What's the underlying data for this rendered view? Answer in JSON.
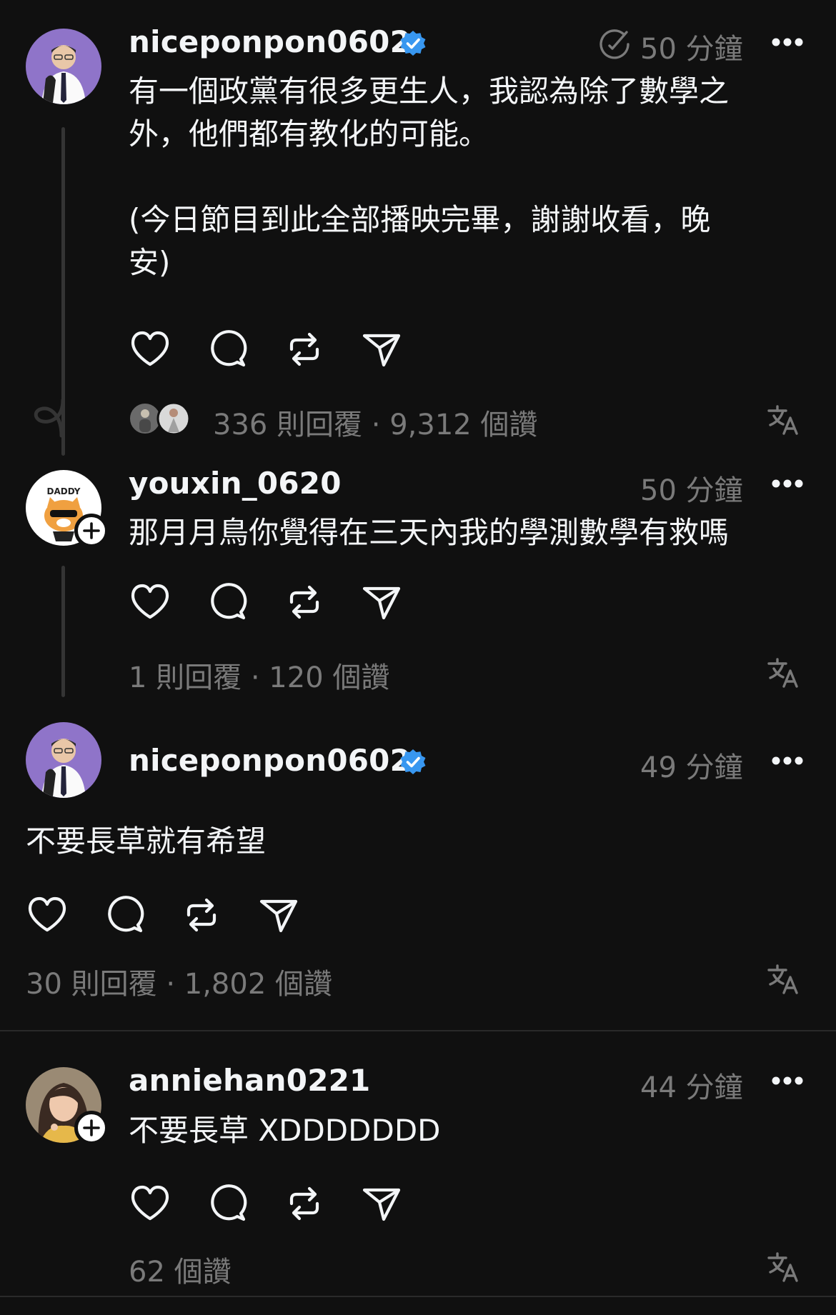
{
  "posts": [
    {
      "username": "niceponpon0602",
      "verified": true,
      "time": "50 分鐘",
      "text": "有一個政黨有很多更生人，我認為除了數學之\n外，他們都有教化的可能。\n\n(今日節目到此全部播映完畢，謝謝收看，晚\n安)",
      "stats": "336 則回覆 · 9,312 個讚"
    },
    {
      "username": "youxin_0620",
      "verified": false,
      "time": "50 分鐘",
      "text": "那月月鳥你覺得在三天內我的學測數學有救嗎",
      "stats": "1 則回覆 · 120 個讚",
      "avatar_label": "DADDY"
    },
    {
      "username": "niceponpon0602",
      "verified": true,
      "time": "49 分鐘",
      "text": "不要長草就有希望",
      "stats": "30 則回覆 · 1,802 個讚"
    },
    {
      "username": "anniehan0221",
      "verified": false,
      "time": "44 分鐘",
      "text": "不要長草 XDDDDDDD",
      "stats": "62 個讚"
    }
  ],
  "icons": {
    "like": "heart-icon",
    "reply": "comment-icon",
    "repost": "repost-icon",
    "share": "send-icon",
    "more": "more-icon",
    "translate": "translate-icon",
    "verified": "verified-badge-icon",
    "edited": "edited-icon"
  },
  "colors": {
    "background": "#101010",
    "text": "#f3f5f7",
    "muted": "#7a7a7a",
    "verified": "#3897f0"
  }
}
